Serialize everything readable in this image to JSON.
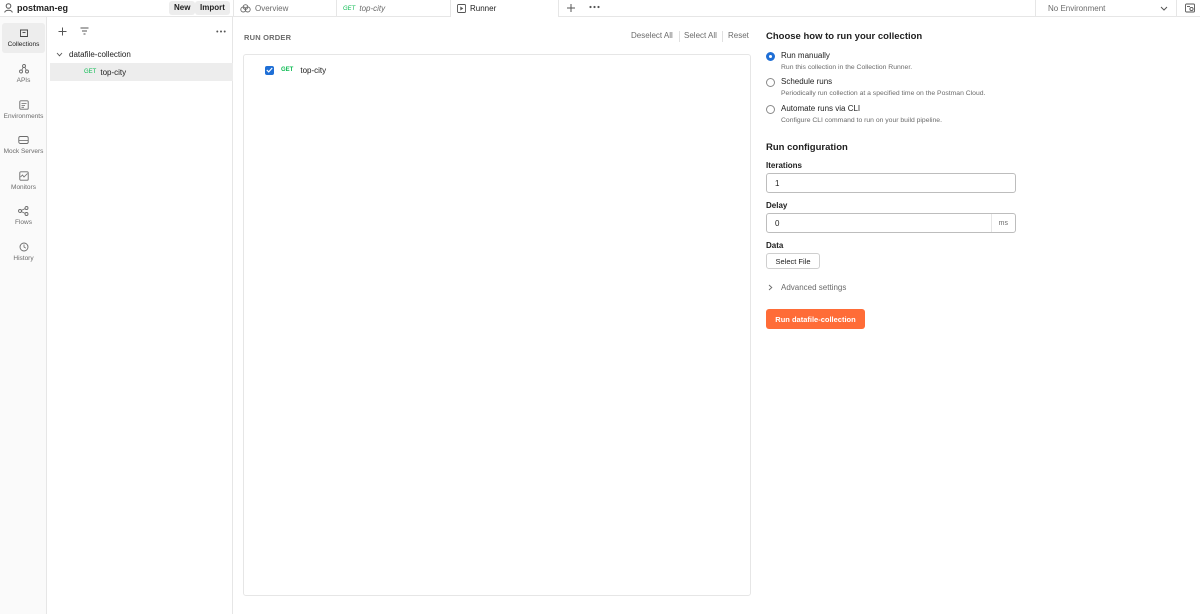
{
  "workspace": {
    "name": "postman-eg"
  },
  "header": {
    "new_label": "New",
    "import_label": "Import"
  },
  "tabs": [
    {
      "label": "Overview",
      "icon": "overview-icon"
    },
    {
      "method": "GET",
      "label": "top-city"
    },
    {
      "label": "Runner",
      "icon": "runner-icon"
    }
  ],
  "environment": {
    "selected": "No Environment"
  },
  "rail": [
    {
      "label": "Collections",
      "icon": "collections-icon",
      "active": true
    },
    {
      "label": "APIs",
      "icon": "apis-icon"
    },
    {
      "label": "Environments",
      "icon": "environments-icon"
    },
    {
      "label": "Mock Servers",
      "icon": "mock-servers-icon"
    },
    {
      "label": "Monitors",
      "icon": "monitors-icon"
    },
    {
      "label": "Flows",
      "icon": "flows-icon"
    },
    {
      "label": "History",
      "icon": "history-icon"
    }
  ],
  "sidebar": {
    "collection": "datafile-collection",
    "request": {
      "method": "GET",
      "name": "top-city"
    }
  },
  "runner": {
    "run_order_title": "RUN ORDER",
    "deselect_all": "Deselect All",
    "select_all": "Select All",
    "reset": "Reset",
    "items": [
      {
        "method": "GET",
        "name": "top-city",
        "checked": true
      }
    ]
  },
  "config": {
    "choose_title": "Choose how to run your collection",
    "options": [
      {
        "label": "Run manually",
        "desc": "Run this collection in the Collection Runner.",
        "checked": true
      },
      {
        "label": "Schedule runs",
        "desc": "Periodically run collection at a specified time on the Postman Cloud.",
        "checked": false
      },
      {
        "label": "Automate runs via CLI",
        "desc": "Configure CLI command to run on your build pipeline.",
        "checked": false
      }
    ],
    "run_config_title": "Run configuration",
    "iterations_label": "Iterations",
    "iterations_value": "1",
    "delay_label": "Delay",
    "delay_value": "0",
    "delay_unit": "ms",
    "data_label": "Data",
    "select_file": "Select File",
    "advanced_settings": "Advanced settings",
    "run_button": "Run datafile-collection"
  },
  "colors": {
    "accent": "#ff6c37",
    "checkbox": "#1f6fd6",
    "get_method": "#0cbb52"
  }
}
